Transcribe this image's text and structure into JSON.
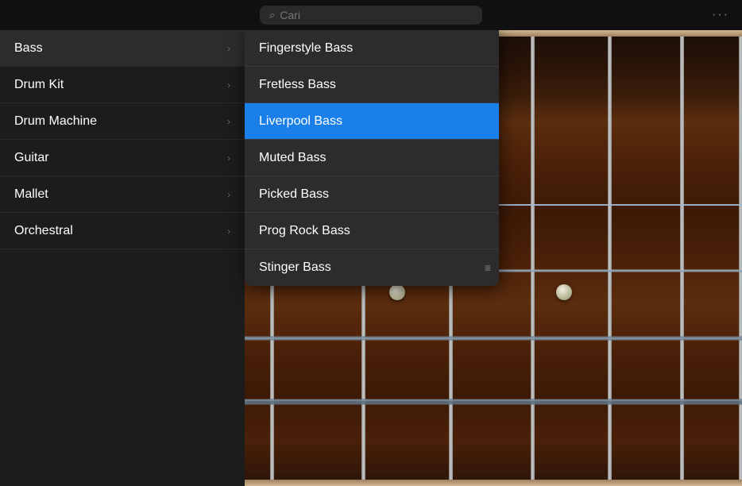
{
  "topbar": {
    "search_placeholder": "Cari",
    "menu_icon": "≡"
  },
  "sidebar": {
    "items": [
      {
        "label": "Bass",
        "active": true,
        "hasSubmenu": true
      },
      {
        "label": "Drum Kit",
        "active": false,
        "hasSubmenu": true
      },
      {
        "label": "Drum Machine",
        "active": false,
        "hasSubmenu": true
      },
      {
        "label": "Guitar",
        "active": false,
        "hasSubmenu": true
      },
      {
        "label": "Mallet",
        "active": false,
        "hasSubmenu": true
      },
      {
        "label": "Orchestral",
        "active": false,
        "hasSubmenu": true
      }
    ]
  },
  "dropdown": {
    "items": [
      {
        "label": "Fingerstyle Bass",
        "selected": false
      },
      {
        "label": "Fretless Bass",
        "selected": false
      },
      {
        "label": "Liverpool Bass",
        "selected": true
      },
      {
        "label": "Muted Bass",
        "selected": false
      },
      {
        "label": "Picked Bass",
        "selected": false
      },
      {
        "label": "Prog Rock Bass",
        "selected": false
      },
      {
        "label": "Stinger Bass",
        "selected": false
      }
    ]
  },
  "icons": {
    "search": "🔍",
    "chevron_right": "›",
    "menu": "···"
  }
}
